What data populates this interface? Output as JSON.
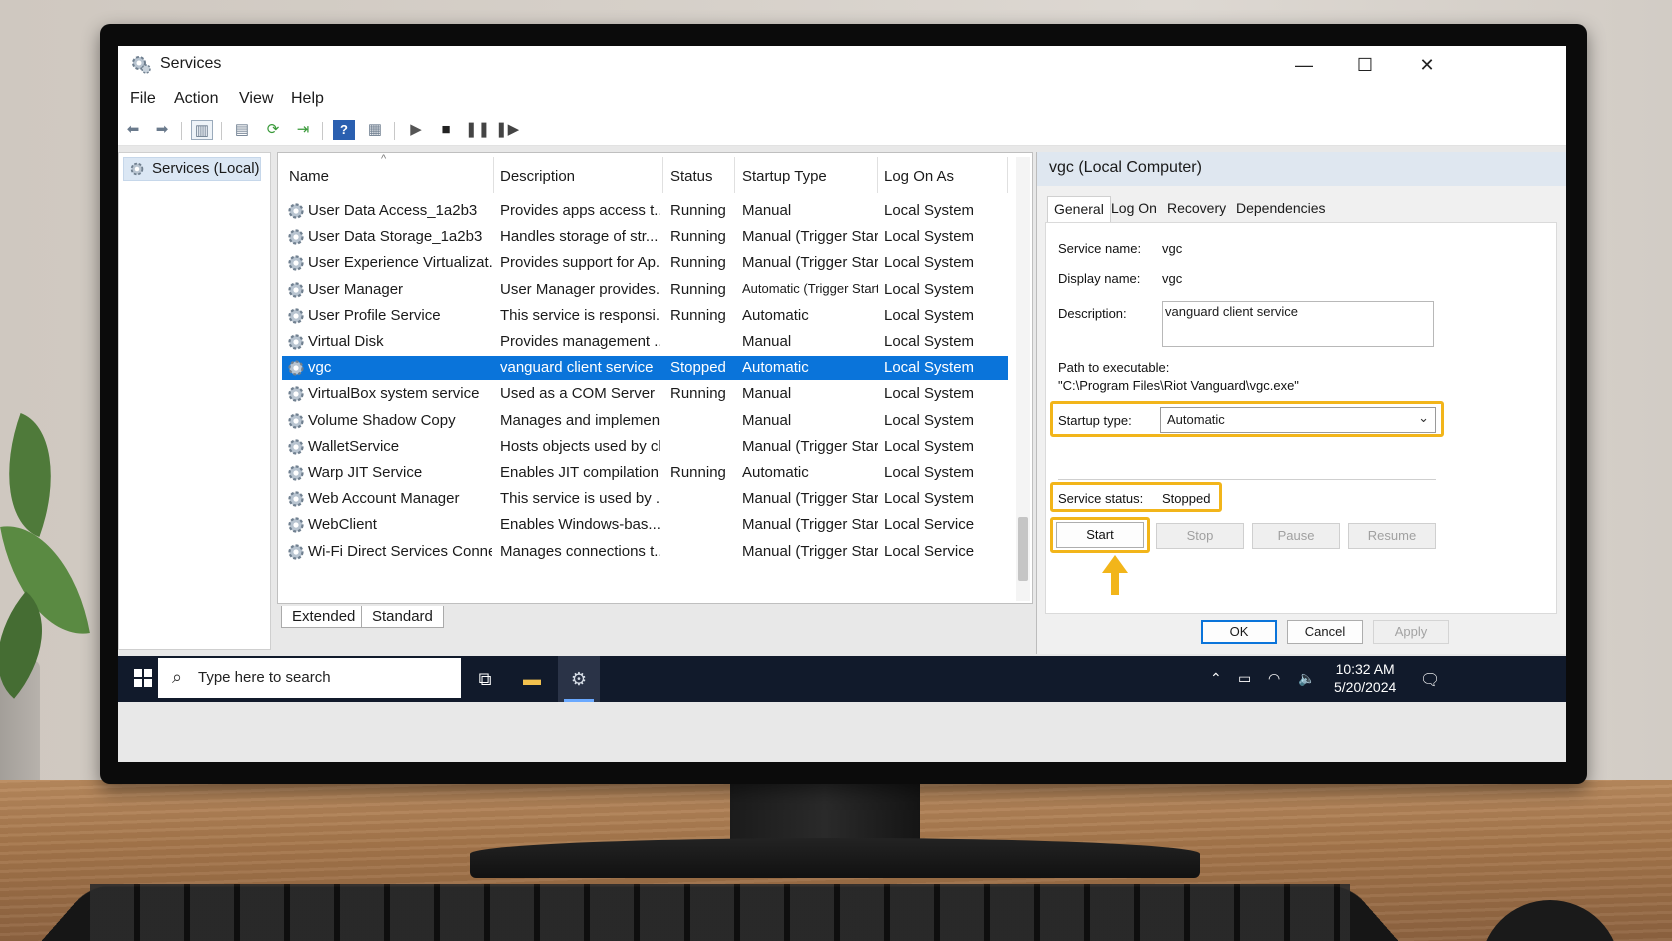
{
  "window": {
    "title": "Services",
    "minimize_glyph": "—",
    "maximize_glyph": "☐",
    "close_glyph": "✕"
  },
  "menu": [
    "File",
    "Action",
    "View",
    "Help"
  ],
  "toolbar": {
    "icons": [
      "back-arrow-icon",
      "forward-arrow-icon",
      "show-hide-tree-icon",
      "properties-icon",
      "refresh-icon",
      "export-list-icon",
      "help-icon",
      "view-icon",
      "play-icon",
      "stop-icon",
      "pause-icon",
      "restart-icon"
    ]
  },
  "tree": {
    "root_label": "Services (Local)"
  },
  "list": {
    "columns": [
      "Name",
      "Description",
      "Status",
      "Startup Type",
      "Log On As"
    ],
    "rows": [
      {
        "name": "User Data Access_1a2b3",
        "description": "Provides apps access t...",
        "status": "Running",
        "startup": "Manual",
        "logon": "Local System"
      },
      {
        "name": "User Data Storage_1a2b3",
        "description": "Handles storage of str...",
        "status": "Running",
        "startup": "Manual (Trigger Start)",
        "logon": "Local System"
      },
      {
        "name": "User Experience Virtualizat...",
        "description": "Provides support for Ap...",
        "status": "Running",
        "startup": "Manual (Trigger Start)",
        "logon": "Local System"
      },
      {
        "name": "User Manager",
        "description": "User Manager provides...",
        "status": "Running",
        "startup": "Automatic (Trigger Start)",
        "logon": "Local System"
      },
      {
        "name": "User Profile Service",
        "description": "This service is responsi...",
        "status": "Running",
        "startup": "Automatic",
        "logon": "Local System"
      },
      {
        "name": "Virtual Disk",
        "description": "Provides management ...",
        "status": "",
        "startup": "Manual",
        "logon": "Local System"
      },
      {
        "name": "vgc",
        "description": "vanguard client service",
        "status": "Stopped",
        "startup": "Automatic",
        "logon": "Local System",
        "selected": true
      },
      {
        "name": "VirtualBox system service",
        "description": "Used as a COM Server ...",
        "status": "Running",
        "startup": "Manual",
        "logon": "Local System"
      },
      {
        "name": "Volume Shadow Copy",
        "description": "Manages and implemen...",
        "status": "",
        "startup": "Manual",
        "logon": "Local System"
      },
      {
        "name": "WalletService",
        "description": "Hosts objects used by cl...",
        "status": "",
        "startup": "Manual (Trigger Start)",
        "logon": "Local System"
      },
      {
        "name": "Warp JIT Service",
        "description": "Enables JIT compilation ...",
        "status": "Running",
        "startup": "Automatic",
        "logon": "Local System"
      },
      {
        "name": "Web Account Manager",
        "description": "This service is used by ...",
        "status": "",
        "startup": "Manual (Trigger Start)",
        "logon": "Local System"
      },
      {
        "name": "WebClient",
        "description": "Enables Windows-bas...",
        "status": "",
        "startup": "Manual (Trigger Start)",
        "logon": "Local Service"
      },
      {
        "name": "Wi-Fi Direct Services Conne...",
        "description": "Manages connections t...",
        "status": "",
        "startup": "Manual (Trigger Start)",
        "logon": "Local Service"
      }
    ],
    "bottom_tabs": [
      "Extended",
      "Standard"
    ]
  },
  "properties": {
    "title": "vgc (Local Computer)",
    "tabs": [
      "General",
      "Log On",
      "Recovery",
      "Dependencies"
    ],
    "service_name_label": "Service name:",
    "service_name": "vgc",
    "display_name_label": "Display name:",
    "display_name": "vgc",
    "description_label": "Description:",
    "description": "vanguard client service",
    "path_label": "Path to executable:",
    "path": "\"C:\\Program Files\\Riot Vanguard\\vgc.exe\"",
    "startup_type_label": "Startup type:",
    "startup_type": "Automatic",
    "service_status_label": "Service status:",
    "service_status": "Stopped",
    "buttons": [
      "Start",
      "Stop",
      "Pause",
      "Resume"
    ],
    "dialog_buttons": [
      "OK",
      "Cancel",
      "Apply"
    ],
    "highlight_color": "#f2b51a"
  },
  "taskbar": {
    "search_placeholder": "Type here to search",
    "time": "10:32 AM",
    "date": "5/20/2024"
  },
  "colors": {
    "selection": "#0a74da",
    "taskbar": "#111a2b"
  }
}
